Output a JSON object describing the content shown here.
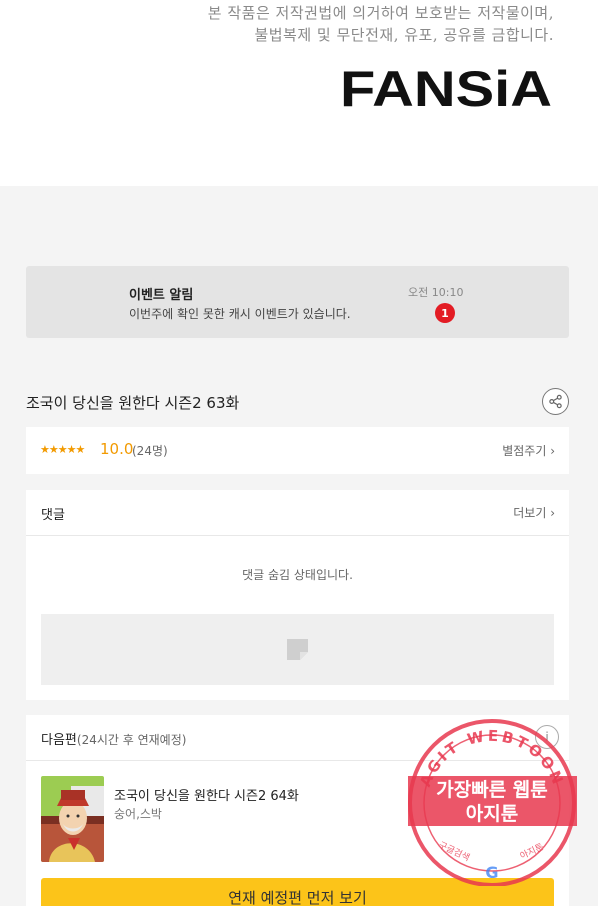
{
  "copyright": {
    "line1": "본 작품은 저작권법에 의거하여 보호받는 저작물이며,",
    "line2": "불법복제 및 무단전재, 유포, 공유를 금합니다."
  },
  "logo": {
    "text": "FANSiA"
  },
  "notice": {
    "title": "이벤트 알림",
    "text": "이번주에 확인 못한 캐시 이벤트가 있습니다.",
    "time": "오전 10:10",
    "badge": "1"
  },
  "episode": {
    "title": "조국이 당신을 원한다 시즌2 63화"
  },
  "rating": {
    "stars": "★★★★★",
    "score": "10.0",
    "count": "(24명)",
    "action": "별점주기 ›"
  },
  "comments": {
    "label": "댓글",
    "more": "더보기 ›",
    "hidden_message": "댓글 숨김 상태입니다."
  },
  "next": {
    "label": "다음편",
    "sub": "(24시간 후 연재예정)",
    "info": "i",
    "title": "조국이 당신을 원한다 시즌2 64화",
    "author": "숭어,스박",
    "cta": "연재 예정편 먼저 보기"
  },
  "stamp": {
    "ring_text": "AGIT WEBTOON",
    "line1": "가장빠른 웹툰",
    "line2": "아지툰",
    "left_small": "구글검색",
    "right_small": "아지툰",
    "google_letter": "G"
  },
  "colors": {
    "accent_star": "#f29a00",
    "badge": "#e31c24",
    "cta": "#fcc419",
    "stamp": "#e8384f"
  }
}
